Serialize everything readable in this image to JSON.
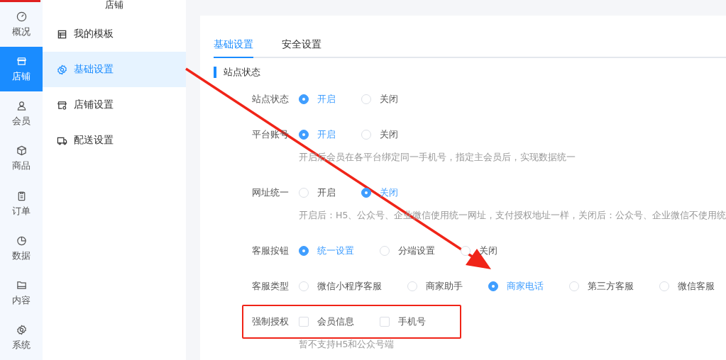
{
  "nav": [
    {
      "label": "概况",
      "selected": false
    },
    {
      "label": "店铺",
      "selected": true
    },
    {
      "label": "会员",
      "selected": false
    },
    {
      "label": "商品",
      "selected": false
    },
    {
      "label": "订单",
      "selected": false
    },
    {
      "label": "数据",
      "selected": false
    },
    {
      "label": "内容",
      "selected": false
    },
    {
      "label": "系统",
      "selected": false
    }
  ],
  "submenu": {
    "title": "店铺",
    "items": [
      {
        "label": "我的模板",
        "selected": false
      },
      {
        "label": "基础设置",
        "selected": true
      },
      {
        "label": "店铺设置",
        "selected": false
      },
      {
        "label": "配送设置",
        "selected": false
      }
    ]
  },
  "tabs": [
    {
      "label": "基础设置",
      "selected": true
    },
    {
      "label": "安全设置",
      "selected": false
    }
  ],
  "section_title": "站点状态",
  "rows": [
    {
      "label": "站点状态",
      "kind": "radio",
      "highlighted": false,
      "options": [
        {
          "label": "开启",
          "selected": true
        },
        {
          "label": "关闭",
          "selected": false
        }
      ]
    },
    {
      "label": "平台账号",
      "kind": "radio",
      "highlighted": false,
      "options": [
        {
          "label": "开启",
          "selected": true
        },
        {
          "label": "关闭",
          "selected": false
        }
      ],
      "hint": "开启后会员在各平台绑定同一手机号，指定主会员后，实现数据统一"
    },
    {
      "label": "网址统一",
      "kind": "radio",
      "highlighted": false,
      "options": [
        {
          "label": "开启",
          "selected": false
        },
        {
          "label": "关闭",
          "selected": true
        }
      ],
      "hint": "开启后：H5、公众号、企业微信使用统一网址，支付授权地址一样，关闭后：公众号、企业微信不使用统"
    },
    {
      "label": "客服按钮",
      "kind": "radio",
      "highlighted": false,
      "options": [
        {
          "label": "统一设置",
          "selected": true
        },
        {
          "label": "分端设置",
          "selected": false
        },
        {
          "label": "关闭",
          "selected": false
        }
      ]
    },
    {
      "label": "客服类型",
      "kind": "radio",
      "highlighted": false,
      "options": [
        {
          "label": "微信小程序客服",
          "selected": false
        },
        {
          "label": "商家助手",
          "selected": false
        },
        {
          "label": "商家电话",
          "selected": true
        },
        {
          "label": "第三方客服",
          "selected": false
        },
        {
          "label": "微信客服",
          "selected": false
        }
      ]
    },
    {
      "label": "强制授权",
      "kind": "checkbox",
      "highlighted": true,
      "options": [
        {
          "label": "会员信息",
          "checked": false
        },
        {
          "label": "手机号",
          "checked": false
        }
      ],
      "hint": "暂不支持H5和公众号端"
    }
  ]
}
